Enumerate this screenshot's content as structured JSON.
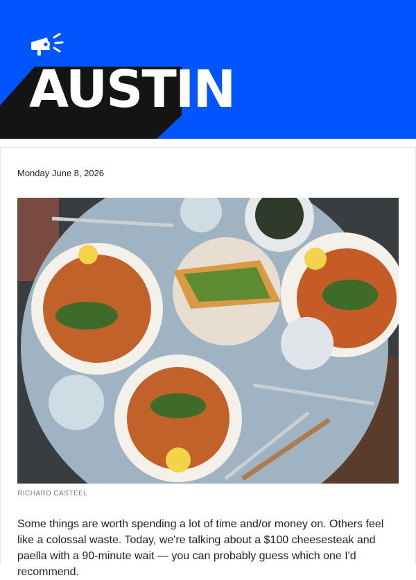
{
  "header": {
    "logo_icon": "megaphone-icon",
    "logo_text": "AUSTIN",
    "colors": {
      "background": "#0055ff",
      "shadow": "#141414",
      "text": "#ffffff"
    }
  },
  "article": {
    "date": "Monday June 8, 2026",
    "photo_credit": "RICHARD CASTEEL",
    "body": "Some things are worth spending a lot of time and/or money on. Others feel like a colossal waste. Today, we're talking about a $100 cheesesteak and paella with a 90-minute wait — you can probably guess which one I'd recommend."
  }
}
